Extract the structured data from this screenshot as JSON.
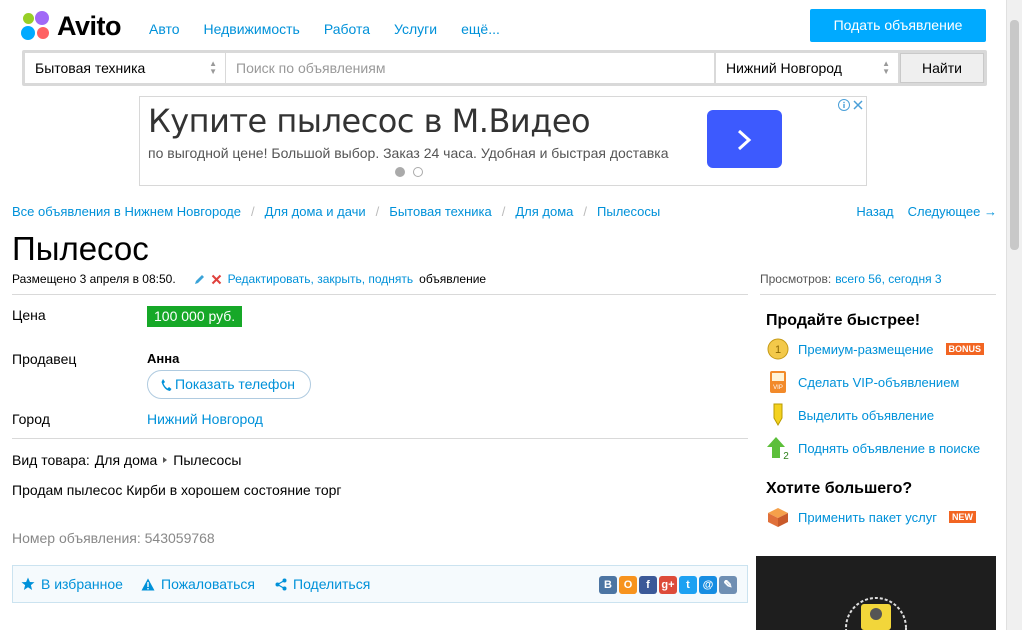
{
  "header": {
    "logo_text": "Avito",
    "nav": [
      "Авто",
      "Недвижимость",
      "Работа",
      "Услуги",
      "ещё..."
    ],
    "post_button": "Подать объявление"
  },
  "search": {
    "category": "Бытовая техника",
    "placeholder": "Поиск по объявлениям",
    "city": "Нижний Новгород",
    "button": "Найти"
  },
  "ad": {
    "title": "Купите пылесос в М.Видео",
    "subtitle": "по выгодной цене! Большой выбор. Заказ 24 часа. Удобная и быстрая доставка"
  },
  "breadcrumbs": [
    "Все объявления в Нижнем Новгороде",
    "Для дома и дачи",
    "Бытовая техника",
    "Для дома",
    "Пылесосы"
  ],
  "pager": {
    "back": "Назад",
    "next": "Следующее →"
  },
  "listing": {
    "title": "Пылесос",
    "posted": "Размещено 3 апреля в 08:50.",
    "edit_link": "Редактировать, закрыть, поднять",
    "edit_suffix": "объявление",
    "views_label": "Просмотров:",
    "views_value": "всего 56, сегодня 3",
    "price_label": "Цена",
    "price": "100 000 руб.",
    "seller_label": "Продавец",
    "seller_name": "Анна",
    "phone_button": "Показать телефон",
    "city_label": "Город",
    "city": "Нижний Новгород",
    "goods_type_label": "Вид товара:",
    "goods_type_1": "Для дома",
    "goods_type_2": "Пылесосы",
    "description": "Продам пылесос Кирби в хорошем состояние торг",
    "ad_number": "Номер объявления: 543059768"
  },
  "actions": {
    "favorite": "В избранное",
    "report": "Пожаловаться",
    "share": "Поделиться"
  },
  "socials": [
    "В",
    "О",
    "f",
    "g+",
    "t",
    "@",
    "✎"
  ],
  "sidebar": {
    "sell_faster": "Продайте быстрее!",
    "premium": "Премиум-размещение",
    "premium_badge": "BONUS",
    "vip": "Сделать VIP-объявлением",
    "highlight": "Выделить объявление",
    "raise": "Поднять объявление в поиске",
    "want_more": "Хотите большего?",
    "package": "Применить пакет услуг",
    "package_badge": "NEW"
  }
}
